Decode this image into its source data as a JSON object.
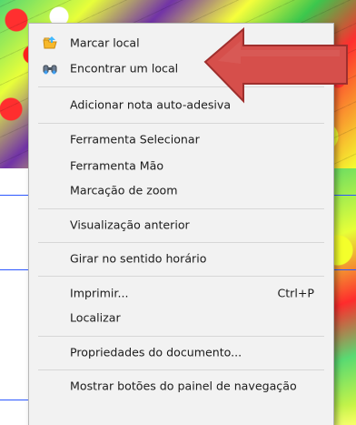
{
  "context_menu": {
    "items": [
      {
        "key": "mark_location",
        "label": "Marcar local",
        "shortcut": ""
      },
      {
        "key": "find_location",
        "label": "Encontrar um local",
        "shortcut": ""
      },
      {
        "key": "add_sticky_note",
        "label": "Adicionar nota auto-adesiva",
        "shortcut": ""
      },
      {
        "key": "select_tool",
        "label": "Ferramenta Selecionar",
        "shortcut": ""
      },
      {
        "key": "hand_tool",
        "label": "Ferramenta Mão",
        "shortcut": ""
      },
      {
        "key": "zoom_marquee",
        "label": "Marcação de zoom",
        "shortcut": ""
      },
      {
        "key": "previous_view",
        "label": "Visualização anterior",
        "shortcut": ""
      },
      {
        "key": "rotate_clockwise",
        "label": "Girar no sentido horário",
        "shortcut": ""
      },
      {
        "key": "print",
        "label": "Imprimir...",
        "shortcut": "Ctrl+P"
      },
      {
        "key": "find",
        "label": "Localizar",
        "shortcut": ""
      },
      {
        "key": "document_properties",
        "label": "Propriedades do documento...",
        "shortcut": ""
      },
      {
        "key": "show_nav_buttons",
        "label": "Mostrar botões do painel de navegação",
        "shortcut": ""
      }
    ]
  },
  "icons": {
    "mark_location": "folder-location-icon",
    "find_location": "binoculars-icon"
  },
  "colors": {
    "arrow_fill": "#d64f4b",
    "arrow_stroke": "#9f2f2d",
    "grid_blue": "#2c57ff",
    "menu_bg": "#f2f2f2"
  }
}
